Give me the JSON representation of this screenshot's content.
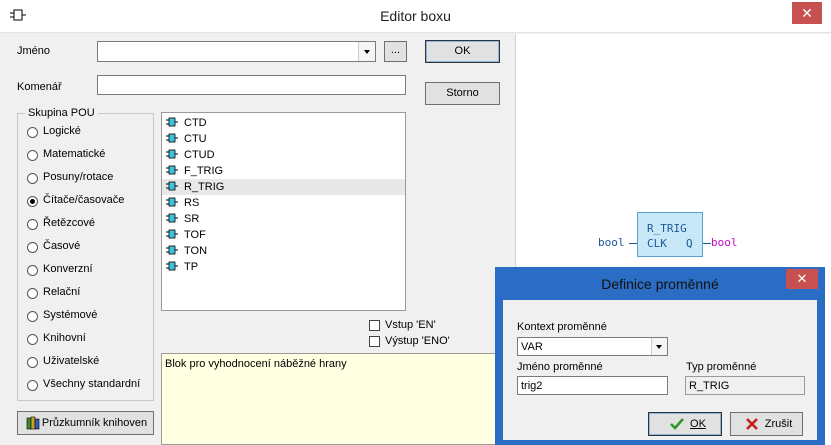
{
  "window": {
    "title": "Editor boxu",
    "close_symbol": "✕"
  },
  "form": {
    "name_label": "Jméno",
    "name_value": "",
    "browse_label": "...",
    "comment_label": "Komenář",
    "comment_value": "",
    "ok_label": "OK",
    "cancel_label": "Storno"
  },
  "pou_group": {
    "title": "Skupina POU",
    "options": [
      {
        "label": "Logické",
        "selected": false
      },
      {
        "label": "Matematické",
        "selected": false
      },
      {
        "label": "Posuny/rotace",
        "selected": false
      },
      {
        "label": "Čítače/časovače",
        "selected": true
      },
      {
        "label": "Řetězcové",
        "selected": false
      },
      {
        "label": "Časové",
        "selected": false
      },
      {
        "label": "Konverzní",
        "selected": false
      },
      {
        "label": "Relační",
        "selected": false
      },
      {
        "label": "Systémové",
        "selected": false
      },
      {
        "label": "Knihovní",
        "selected": false
      },
      {
        "label": "Uživatelské",
        "selected": false
      },
      {
        "label": "Všechny standardní",
        "selected": false
      }
    ]
  },
  "library_button_label": "Průzkumník knihoven",
  "blocks": [
    {
      "name": "CTD"
    },
    {
      "name": "CTU"
    },
    {
      "name": "CTUD"
    },
    {
      "name": "F_TRIG"
    },
    {
      "name": "R_TRIG"
    },
    {
      "name": "RS"
    },
    {
      "name": "SR"
    },
    {
      "name": "TOF"
    },
    {
      "name": "TON"
    },
    {
      "name": "TP"
    }
  ],
  "selected_block": "R_TRIG",
  "options": {
    "en_label": "Vstup 'EN'",
    "eno_label": "Výstup 'ENO'"
  },
  "description": "Blok pro vyhodnocení náběžné hrany",
  "preview": {
    "block_name": "R_TRIG",
    "input_pin": "CLK",
    "output_pin": "Q",
    "input_type": "bool",
    "output_type": "bool"
  },
  "variable_dialog": {
    "title": "Definice proměnné",
    "close_symbol": "✕",
    "context_label": "Kontext proměnné",
    "context_value": "VAR",
    "name_label": "Jméno proměnné",
    "name_value": "trig2",
    "type_label": "Typ proměnné",
    "type_value": "R_TRIG",
    "ok_label": "OK",
    "cancel_label": "Zrušit"
  },
  "colors": {
    "dialog_border": "#2b6cc4",
    "close_button": "#c75050",
    "description_bg": "#ffffe1",
    "block_fill": "#c8e8f8",
    "type_color": "#c010c0",
    "pin_color": "#1a5a9a"
  }
}
